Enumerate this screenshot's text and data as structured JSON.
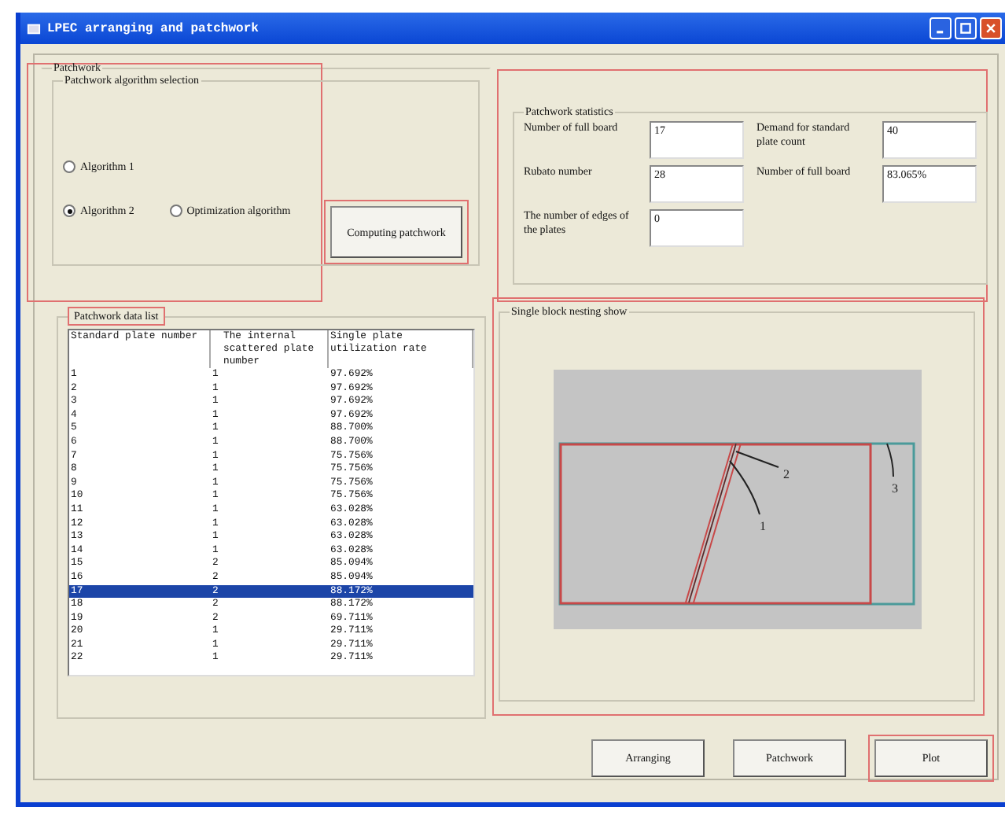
{
  "window": {
    "title": "LPEC arranging and patchwork"
  },
  "patchwork": {
    "legend": "Patchwork",
    "annotated": true,
    "algorithm_group": {
      "legend": "Patchwork algorithm selection",
      "radios": [
        {
          "label": "Algorithm 1",
          "selected": false
        },
        {
          "label": "Algorithm 2",
          "selected": true
        },
        {
          "label": "Optimization algorithm",
          "selected": false
        }
      ]
    },
    "compute_button": {
      "label": "Computing patchwork",
      "annotated": true
    }
  },
  "statistics": {
    "legend": "Patchwork statistics",
    "annotated": true,
    "fields": [
      {
        "label": "Number of full board",
        "value": "17"
      },
      {
        "label": "Demand for standard plate count",
        "value": "40"
      },
      {
        "label": "Rubato number",
        "value": "28"
      },
      {
        "label": "Number of full board",
        "value": "83.065%"
      },
      {
        "label": "The number of edges of the plates",
        "value": "0"
      }
    ]
  },
  "data_list": {
    "legend": "Patchwork data list",
    "annotated": true,
    "columns": [
      "Standard plate number",
      "The internal scattered plate number",
      "Single plate utilization rate"
    ],
    "rows": [
      {
        "cells": [
          "1",
          "1",
          "97.692%"
        ],
        "selected": false
      },
      {
        "cells": [
          "2",
          "1",
          "97.692%"
        ],
        "selected": false
      },
      {
        "cells": [
          "3",
          "1",
          "97.692%"
        ],
        "selected": false
      },
      {
        "cells": [
          "4",
          "1",
          "97.692%"
        ],
        "selected": false
      },
      {
        "cells": [
          "5",
          "1",
          "88.700%"
        ],
        "selected": false
      },
      {
        "cells": [
          "6",
          "1",
          "88.700%"
        ],
        "selected": false
      },
      {
        "cells": [
          "7",
          "1",
          "75.756%"
        ],
        "selected": false
      },
      {
        "cells": [
          "8",
          "1",
          "75.756%"
        ],
        "selected": false
      },
      {
        "cells": [
          "9",
          "1",
          "75.756%"
        ],
        "selected": false
      },
      {
        "cells": [
          "10",
          "1",
          "75.756%"
        ],
        "selected": false
      },
      {
        "cells": [
          "11",
          "1",
          "63.028%"
        ],
        "selected": false
      },
      {
        "cells": [
          "12",
          "1",
          "63.028%"
        ],
        "selected": false
      },
      {
        "cells": [
          "13",
          "1",
          "63.028%"
        ],
        "selected": false
      },
      {
        "cells": [
          "14",
          "1",
          "63.028%"
        ],
        "selected": false
      },
      {
        "cells": [
          "15",
          "2",
          "85.094%"
        ],
        "selected": false
      },
      {
        "cells": [
          "16",
          "2",
          "85.094%"
        ],
        "selected": false
      },
      {
        "cells": [
          "17",
          "2",
          "88.172%"
        ],
        "selected": true
      },
      {
        "cells": [
          "18",
          "2",
          "88.172%"
        ],
        "selected": false
      },
      {
        "cells": [
          "19",
          "2",
          "69.711%"
        ],
        "selected": false
      },
      {
        "cells": [
          "20",
          "1",
          "29.711%"
        ],
        "selected": false
      },
      {
        "cells": [
          "21",
          "1",
          "29.711%"
        ],
        "selected": false
      },
      {
        "cells": [
          "22",
          "1",
          "29.711%"
        ],
        "selected": false
      }
    ]
  },
  "nesting": {
    "legend": "Single block nesting show",
    "annotated": true,
    "callouts": [
      "1",
      "2",
      "3"
    ]
  },
  "buttons": [
    {
      "label": "Arranging",
      "annotated": false
    },
    {
      "label": "Patchwork",
      "annotated": false
    },
    {
      "label": "Plot",
      "annotated": true
    }
  ]
}
